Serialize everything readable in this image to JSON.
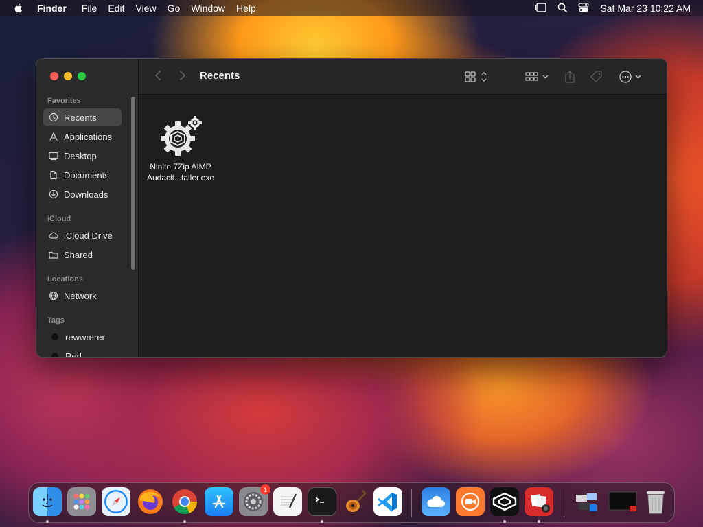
{
  "menubar": {
    "app_name": "Finder",
    "menus": [
      "File",
      "Edit",
      "View",
      "Go",
      "Window",
      "Help"
    ],
    "clock": "Sat Mar 23  10:22 AM"
  },
  "window": {
    "title": "Recents",
    "sidebar": {
      "favorites_label": "Favorites",
      "favorites": [
        "Recents",
        "Applications",
        "Desktop",
        "Documents",
        "Downloads"
      ],
      "icloud_label": "iCloud",
      "icloud": [
        "iCloud Drive",
        "Shared"
      ],
      "locations_label": "Locations",
      "locations": [
        "Network"
      ],
      "tags_label": "Tags",
      "tags": [
        "rewwrerer",
        "Red"
      ]
    },
    "files": [
      {
        "name_line1": "Ninite 7Zip AIMP",
        "name_line2": "Audacit...taller.exe"
      }
    ]
  },
  "dock": {
    "apps": [
      "finder-icon",
      "launchpad-icon",
      "safari-icon",
      "firefox-icon",
      "chrome-icon",
      "app-store-icon",
      "system-settings-icon",
      "textedit-icon",
      "terminal-icon",
      "garageband-icon",
      "vscode-icon",
      "weather-icon",
      "screen-recorder-icon",
      "ninite-icon",
      "photo-booth-icon",
      "downloads-stack-icon",
      "screenshot-stack-icon",
      "trash-icon"
    ],
    "settings_badge": "1"
  },
  "colors": {
    "traffic_red": "#ff5f57",
    "traffic_yellow": "#febc2e",
    "traffic_green": "#28c840",
    "sidebar_active": "#474648"
  }
}
